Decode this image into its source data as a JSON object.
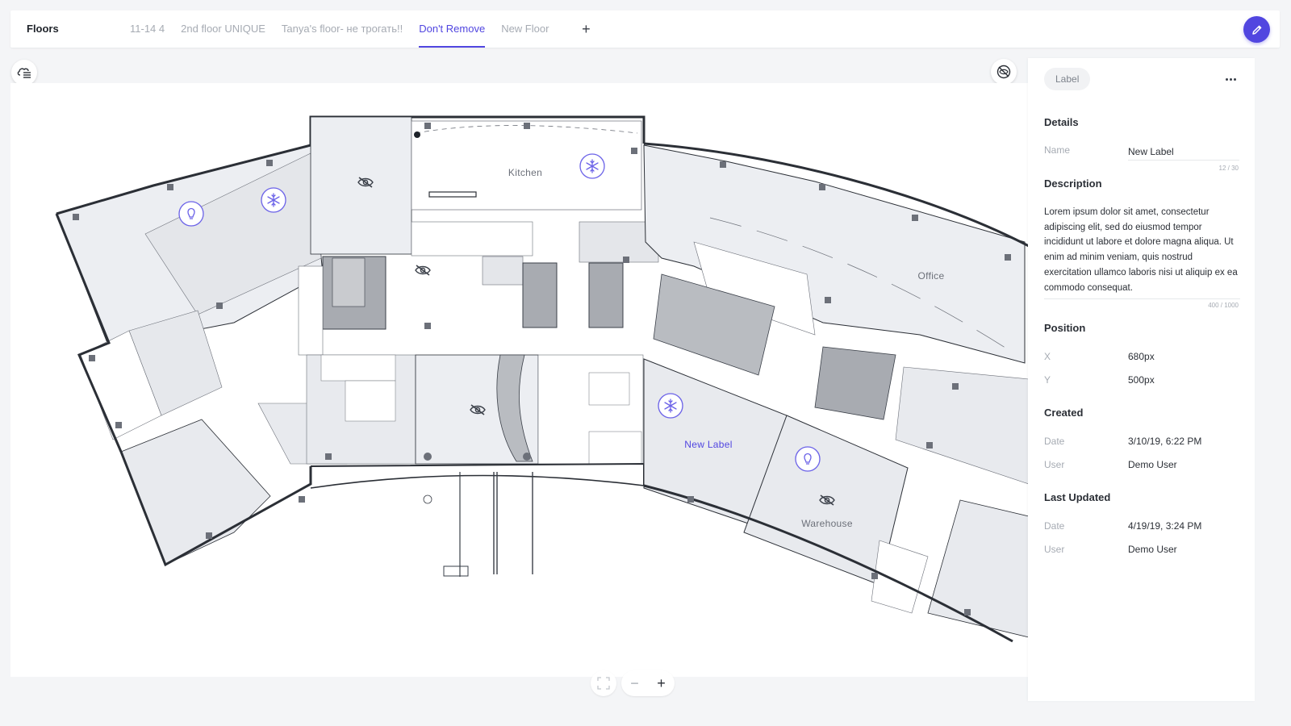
{
  "header": {
    "title": "Floors",
    "tabs": [
      {
        "label": "11-14 4",
        "active": false
      },
      {
        "label": "2nd floor UNIQUE",
        "active": false
      },
      {
        "label": "Tanya's floor- не трогать!!",
        "active": false
      },
      {
        "label": "Don't Remove",
        "active": true
      },
      {
        "label": "New Floor",
        "active": false
      }
    ],
    "add_tab": "+"
  },
  "floorplan": {
    "rooms": {
      "kitchen": "Kitchen",
      "office": "Office",
      "new_label": "New Label",
      "warehouse": "Warehouse"
    },
    "icons": [
      "snowflake-icon",
      "lightbulb-icon",
      "eye-off-icon"
    ]
  },
  "zoom": {
    "minus": "−",
    "plus": "+"
  },
  "panel": {
    "chip": "Label",
    "details": {
      "title": "Details",
      "name_label": "Name",
      "name_value": "New Label",
      "name_counter": "12 / 30"
    },
    "description": {
      "title": "Description",
      "text": "Lorem ipsum dolor sit amet, consectetur adipiscing elit, sed do eiusmod tempor incididunt ut labore et dolore magna aliqua. Ut enim ad minim veniam, quis nostrud exercitation ullamco laboris nisi ut aliquip ex ea commodo consequat.",
      "counter": "400 / 1000"
    },
    "position": {
      "title": "Position",
      "x_label": "X",
      "x_value": "680px",
      "y_label": "Y",
      "y_value": "500px"
    },
    "created": {
      "title": "Created",
      "date_label": "Date",
      "date_value": "3/10/19, 6:22 PM",
      "user_label": "User",
      "user_value": "Demo User"
    },
    "updated": {
      "title": "Last Updated",
      "date_label": "Date",
      "date_value": "4/19/19, 3:24 PM",
      "user_label": "User",
      "user_value": "Demo User"
    }
  },
  "colors": {
    "accent": "#5146e0",
    "room_fill": "#eceef2",
    "wall": "#2b2f36",
    "muted_text": "#a6abb3"
  }
}
